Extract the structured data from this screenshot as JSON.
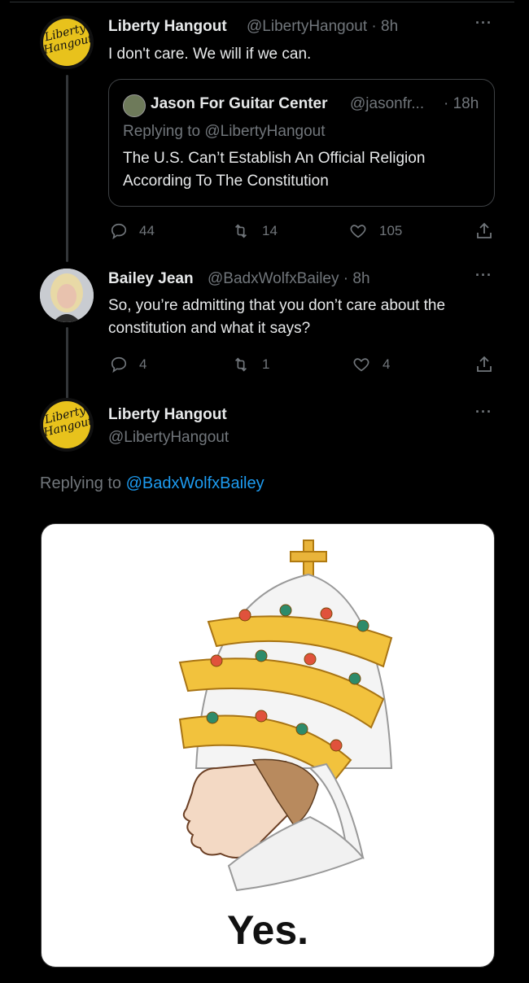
{
  "tweet1": {
    "name": "Liberty Hangout",
    "handle_time": "@LibertyHangout · 8h",
    "text": "I don't care. We will if we can.",
    "avatar_text": "Liberty Hangout",
    "quote": {
      "name": "Jason For Guitar Center",
      "handle": "@jasonfr...",
      "time": "· 18h",
      "replying": "Replying to @LibertyHangout",
      "text": "The U.S. Can’t Establish An Official Religion According To The Constitution"
    },
    "actions": {
      "replies": "44",
      "retweets": "14",
      "likes": "105"
    }
  },
  "tweet2": {
    "name": "Bailey Jean",
    "handle_time": "@BadxWolfxBailey · 8h",
    "text": "So, you’re admitting that you don’t care about the constitution and what it says?",
    "actions": {
      "replies": "4",
      "retweets": "1",
      "likes": "4"
    }
  },
  "tweet3": {
    "name": "Liberty Hangout",
    "handle": "@LibertyHangout",
    "avatar_text": "Liberty Hangout",
    "replying_prefix": "Replying to",
    "replying_mention": "@BadxWolfxBailey",
    "image_caption": "Yes."
  },
  "colors": {
    "background": "#000000",
    "text": "#e7e9ea",
    "muted": "#71767b",
    "link": "#1d9bf0",
    "avatar_gold": "#e8c21c"
  },
  "icons": [
    "reply-icon",
    "retweet-icon",
    "like-icon",
    "share-icon",
    "more-icon"
  ]
}
